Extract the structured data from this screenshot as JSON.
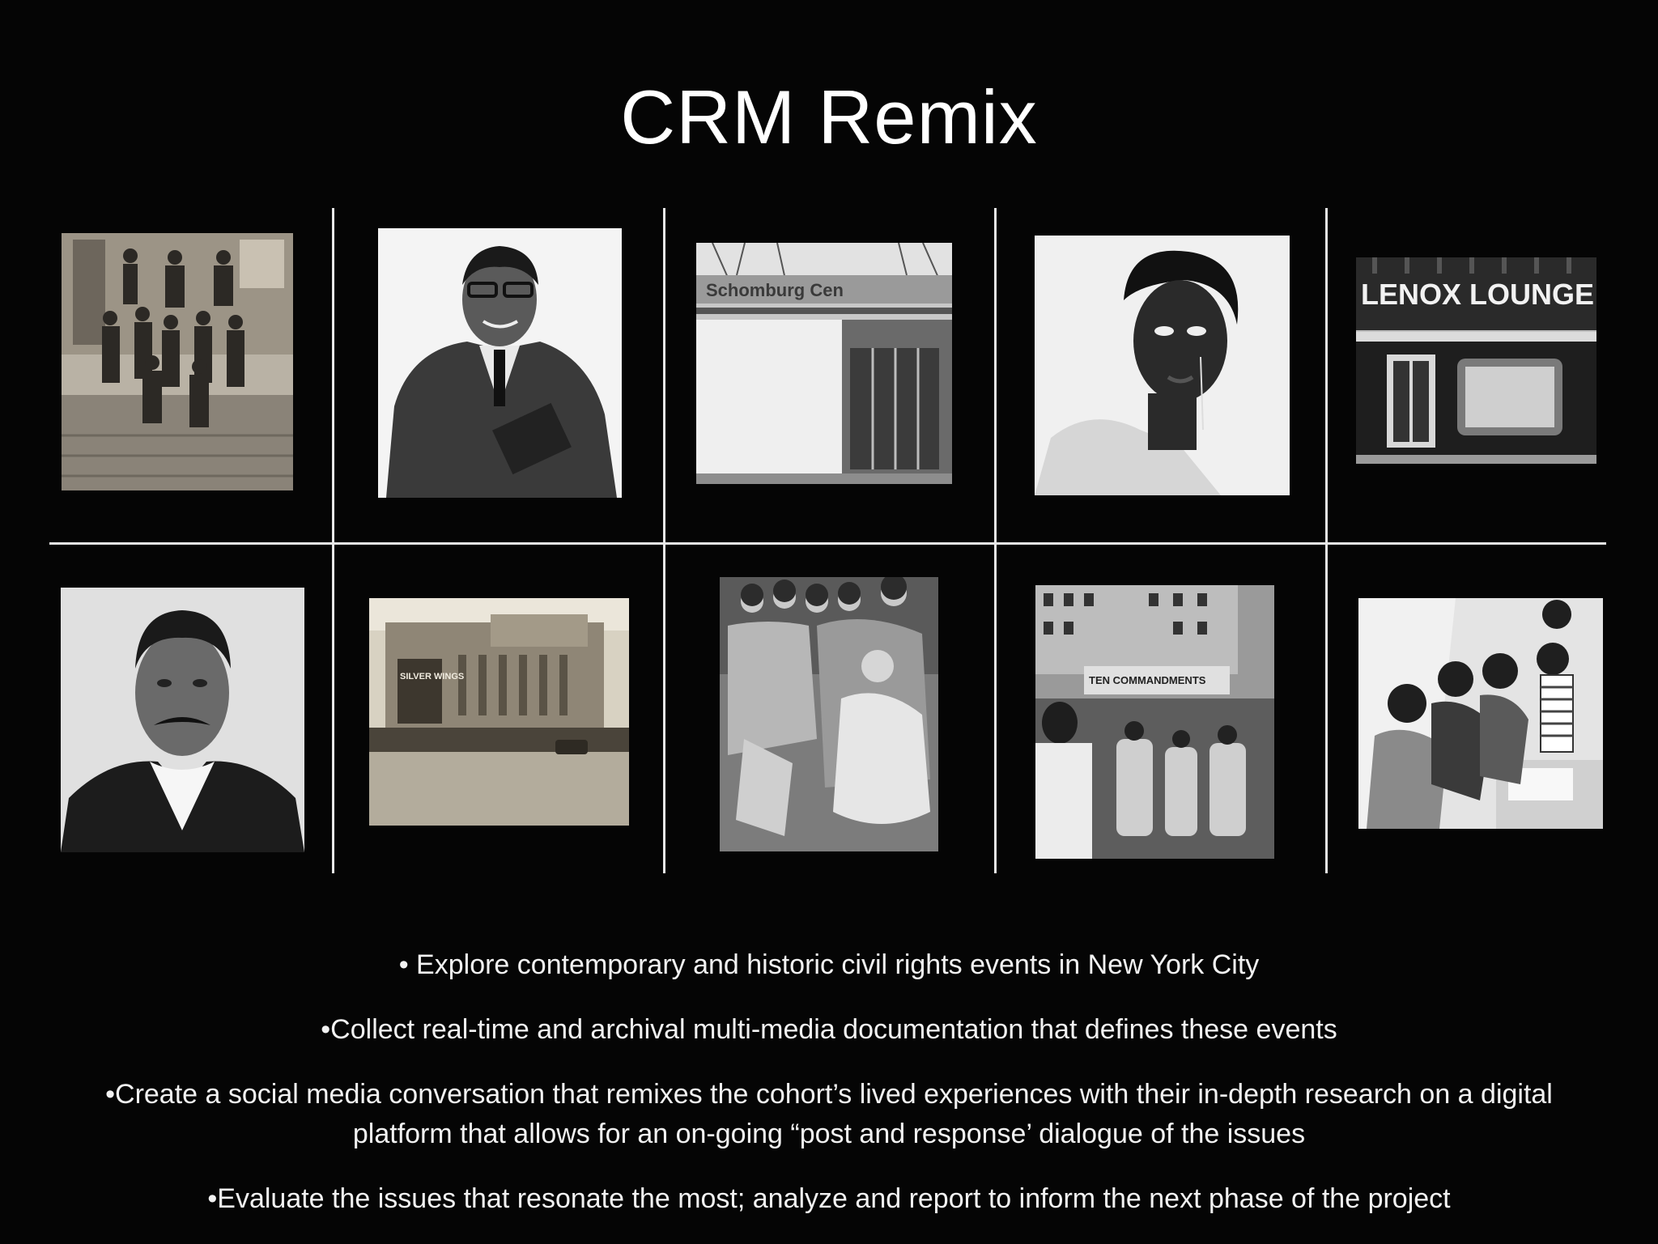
{
  "slide": {
    "title": "CRM Remix"
  },
  "photos": {
    "lenox_sign": "LENOX LOUNGE",
    "schomburg_sign": "Schomburg Cen",
    "theater_sign": "SILVER WINGS",
    "marquee_sign": "TEN COMMANDMENTS"
  },
  "bullets": [
    "•  Explore contemporary and historic civil rights events in New York City",
    "•Collect real-time and archival multi-media documentation that defines these events",
    "•Create a social media conversation that remixes the cohort’s lived experiences with their in-depth research on a digital platform that allows for an on-going “post and response’  dialogue of the issues",
    "•Evaluate the issues that resonate the most; analyze and report to inform the next phase of the project"
  ]
}
